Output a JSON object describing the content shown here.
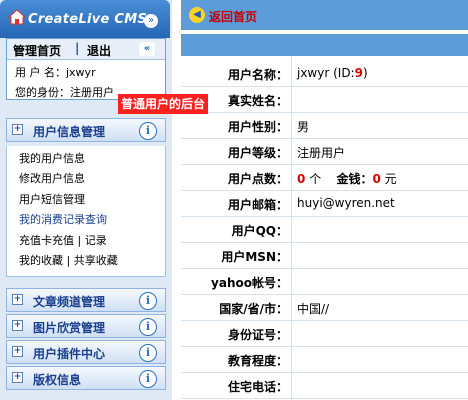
{
  "sidebar": {
    "cms_title": "CreateLive CMS",
    "admin_home": "管理首页",
    "separator": "|",
    "logout": "退出",
    "username_line": "用 户 名：jxwyr",
    "identity_line": "您的身份：注册用户",
    "callout": "普通用户的后台",
    "section_user_info": "用户信息管理",
    "menu_items": [
      "我的用户信息",
      "修改用户信息",
      "用户短信管理",
      "我的消费记录查询",
      "充值卡充值 | 记录",
      "我的收藏 | 共享收藏"
    ],
    "section_article": "文章频道管理",
    "section_gallery": "图片欣赏管理",
    "section_plugins": "用户插件中心",
    "section_copyright": "版权信息",
    "plus": "+",
    "info": "i",
    "collapse": "«",
    "toggle": "»"
  },
  "main": {
    "back_home": "返回首页",
    "rows": [
      {
        "label": "用户名称：",
        "value_prefix": "jxwyr (ID:",
        "value_id": "9",
        "value_suffix": ")"
      },
      {
        "label": "真实姓名：",
        "value": ""
      },
      {
        "label": "用户性别：",
        "value": "男"
      },
      {
        "label": "用户等级：",
        "value": "注册用户"
      },
      {
        "label": "用户点数：",
        "points": "0",
        "points_unit": "个",
        "money_label": "金钱：",
        "money": "0",
        "money_unit": "元"
      },
      {
        "label": "用户邮箱：",
        "value": "huyi@wyren.net"
      },
      {
        "label": "用户QQ：",
        "value": ""
      },
      {
        "label": "用户MSN：",
        "value": ""
      },
      {
        "label": "yahoo帐号：",
        "value": ""
      },
      {
        "label": "国家/省/市：",
        "value": "中国//"
      },
      {
        "label": "身份证号：",
        "value": ""
      },
      {
        "label": "教育程度：",
        "value": ""
      },
      {
        "label": "住宅电话：",
        "value": ""
      }
    ]
  },
  "colors": {
    "accent": "#5b9cd9",
    "header": "#2566b5",
    "red": "#e00000",
    "link_blue": "#1a3fbf"
  }
}
